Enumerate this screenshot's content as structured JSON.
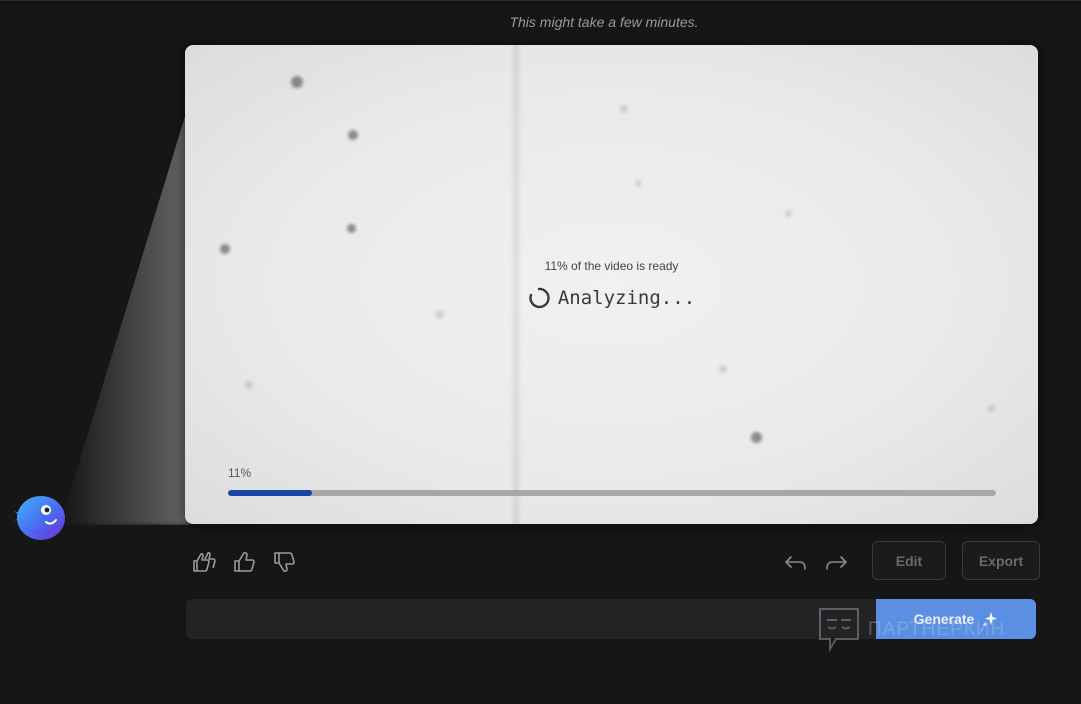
{
  "header": {
    "hint": "This might take a few minutes."
  },
  "preview": {
    "ready_text": "11% of the video is ready",
    "status_text": "Analyzing...",
    "progress_label": "11%",
    "progress_fraction": 0.11
  },
  "toolbar": {
    "rate_both_icon": "double-thumbs-up-icon",
    "like_icon": "thumbs-up-icon",
    "dislike_icon": "thumbs-down-icon",
    "undo_icon": "undo-icon",
    "redo_icon": "redo-icon",
    "edit_label": "Edit",
    "export_label": "Export"
  },
  "composer": {
    "prompt_value": "",
    "generate_label": "Generate",
    "generate_icon": "sparkle-icon"
  },
  "watermark": {
    "text": "ПАРТНЕРКИН"
  },
  "colors": {
    "background": "#161616",
    "progress_fill": "#1a46a8",
    "progress_track": "#a8a8a8",
    "generate_button": "#5b8fe4"
  }
}
